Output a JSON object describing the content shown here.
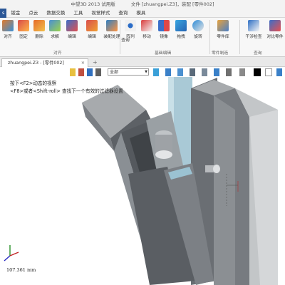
{
  "window": {
    "app_title": "中望3D 2013 试用版",
    "file_title": "文件 [zhuangpei.Z3]，装配 [零件002]"
  },
  "menu": {
    "tabs": [
      "s",
      "钣金",
      "点云",
      "数据交换",
      "工具",
      "视觉样式",
      "查询",
      "模具"
    ]
  },
  "ribbon": {
    "buttons": [
      {
        "label": "对齐",
        "icon": "align-icon"
      },
      {
        "label": "固定",
        "icon": "fix-icon"
      },
      {
        "label": "删除",
        "icon": "delete-icon"
      },
      {
        "label": "求解",
        "icon": "solve-icon"
      },
      {
        "label": "编辑",
        "icon": "edit-icon"
      },
      {
        "label": "编辑",
        "icon": "edit2-icon"
      },
      {
        "label": "装配处理",
        "icon": "assembly-process-icon"
      },
      {
        "label": "查询",
        "icon": "query-icon"
      },
      {
        "label": "阵列",
        "icon": "pattern-icon"
      },
      {
        "label": "移动",
        "icon": "move-icon"
      },
      {
        "label": "镜像",
        "icon": "mirror-icon"
      },
      {
        "label": "拖拽",
        "icon": "drag-icon"
      },
      {
        "label": "旋转",
        "icon": "rotate-icon"
      },
      {
        "label": "零件库",
        "icon": "part-library-icon"
      },
      {
        "label": "干涉检查",
        "icon": "interference-check-icon"
      },
      {
        "label": "对比零件",
        "icon": "compare-part-icon"
      }
    ],
    "groups": [
      "对齐",
      "基础编辑",
      "零件制造",
      "查询"
    ]
  },
  "document": {
    "tab_label": "zhuangpei.Z3 - [零件002]",
    "close": "×",
    "new_tab": "+"
  },
  "viewport": {
    "filter_value": "全部",
    "hint_line1": "按下<F2>动态的视察",
    "hint_line2": "<F8>或者<Shift-roll> 查找下一个有效的过滤器设置",
    "status_value": "107.361 mm"
  },
  "colors": {
    "accent": "#2b5797",
    "part_dark": "#5d6166",
    "part_mid": "#8a8f94",
    "part_light": "#b9bcbf",
    "shaft_blue": "#a9c9d6"
  }
}
